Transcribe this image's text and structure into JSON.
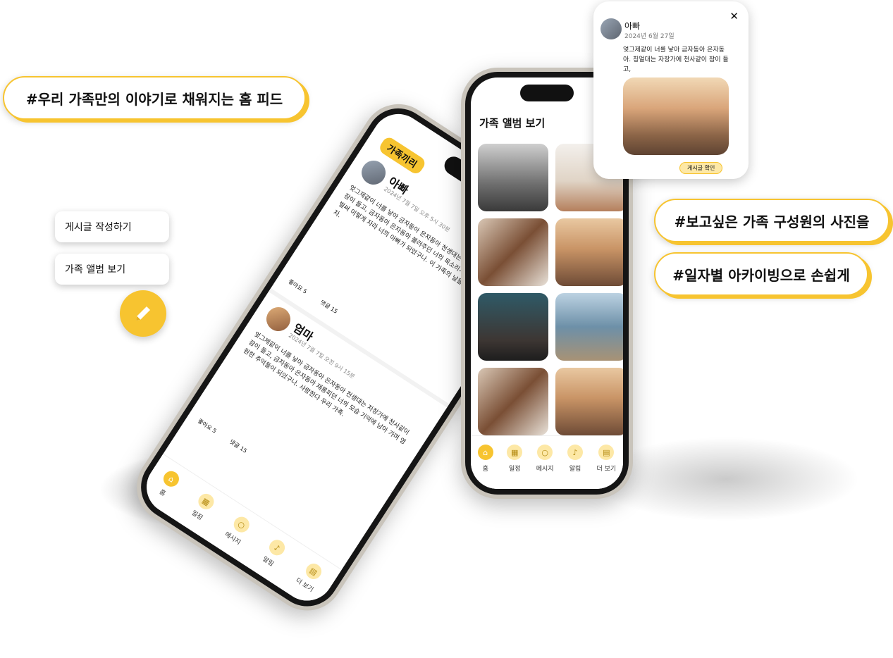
{
  "tags": {
    "home_feed": "#우리 가족만의 이야기로 채워지는 홈 피드",
    "photos": "#보고싶은 가족 구성원의 사진을",
    "archive": "#일자별 아카이빙으로 손쉽게"
  },
  "left_menu": {
    "write_post": "게시글 작성하기",
    "view_album": "가족 앨범 보기"
  },
  "feed_phone": {
    "app_logo": "가족끼리",
    "posts": [
      {
        "author": "아빠",
        "date": "2024년 7월 7일  오후 5시 30분",
        "body": "엊그제같이 너를 낳아 금자동아 은자동아 천생대는 자장가에 천사같이 잠이 들고, 금자동아 은자동아 불러주던 너의 목소리가 아직도 생생한데 벌써 이렇게 자라 너의 아빠가 되었구나. 이 가족의 날들을 함께 기억하자.",
        "likes": "좋아요 5",
        "comments": "댓글 15"
      },
      {
        "author": "엄마",
        "date": "2024년 7월 7일  오전 9시 15분",
        "body": "엊그제같이 너를 낳아 금자동아 은자동아 천생대는 자장가에 천사같이 잠이 들고, 금자동아 은자동아 재롱피던 너의 모습 기억에 남아 가며 영원한 추억들이 되었구나. 사랑한다 우리 가족.",
        "likes": "좋아요 5",
        "comments": "댓글 15"
      }
    ],
    "nav": [
      "홈",
      "일정",
      "메시지",
      "알림",
      "더 보기"
    ]
  },
  "album_phone": {
    "title": "가족 앨범 보기",
    "nav": [
      "홈",
      "일정",
      "메시지",
      "알림",
      "더 보기"
    ]
  },
  "popup": {
    "author": "아빠",
    "date": "2024년 6월 27일",
    "body": "엊그제같이 너를 낳아 금자동아 은자동아. 칭얼대는 자장가에  천사같이 잠이 들고,",
    "confirm": "게시글 확인",
    "close": "✕"
  },
  "colors": {
    "accent": "#f7c430",
    "accent_light": "#fde8a6"
  }
}
